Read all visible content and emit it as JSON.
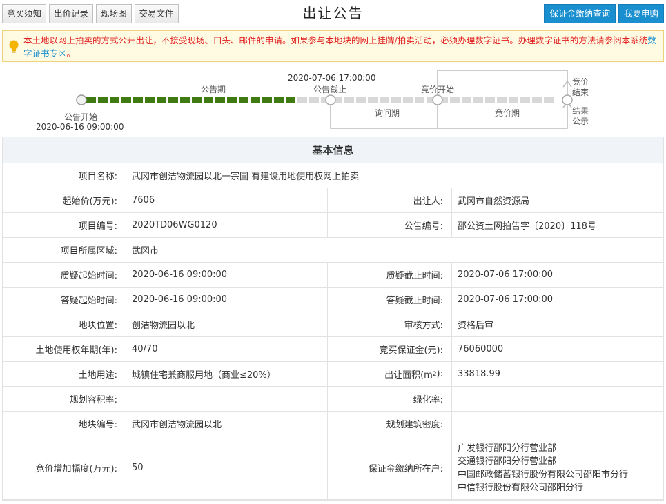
{
  "toolbar": {
    "tabs": [
      "竞买须知",
      "出价记录",
      "现场图",
      "交易文件"
    ],
    "title": "出让公告",
    "buttons": [
      "保证金缴纳查询",
      "我要申购"
    ]
  },
  "notice": {
    "text1": "本土地以网上拍卖的方式公开出让，不接受现场、口头、邮件的申请。如果参与本地块的网上挂牌/拍卖活动，必须办理数字证书。办理数字证书的方法请参阅本系统",
    "link": "数字证书专区",
    "text2": "。"
  },
  "timeline": {
    "start_label": "公告开始",
    "start_time": "2020-06-16 09:00:00",
    "period_label": "公告期",
    "deadline_time": "2020-07-06 17:00:00",
    "deadline_label": "公告截止",
    "inquiry_label": "询问期",
    "bid_start_label": "竞价开始",
    "bid_period_label": "竞价期",
    "bid_end_label1": "竞价",
    "bid_end_label2": "结束",
    "result_label1": "结果",
    "result_label2": "公示",
    "progress_fraction": 0.45,
    "colors": {
      "done": "#3f7a12",
      "pending": "#d8d8d8"
    }
  },
  "info": {
    "heading": "基本信息",
    "project_name_label": "项目名称:",
    "project_name": "武冈市创洁物流园以北一宗国 有建设用地使用权网上拍卖",
    "start_price_label": "起始价(万元):",
    "start_price": "7606",
    "seller_label": "出让人:",
    "seller": "武冈市自然资源局",
    "project_no_label": "项目编号:",
    "project_no": "2020TD06WG0120",
    "notice_no_label": "公告编号:",
    "notice_no": "邵公资土网拍告字〔2020〕118号",
    "region_label": "项目所属区域:",
    "region": "武冈市",
    "q_start_label": "质疑起始时间:",
    "q_start": "2020-06-16 09:00:00",
    "q_end_label": "质疑截止时间:",
    "q_end": "2020-07-06 17:00:00",
    "a_start_label": "答疑起始时间:",
    "a_start": "2020-06-16 09:00:00",
    "a_end_label": "答疑截止时间:",
    "a_end": "2020-07-06 17:00:00",
    "location_label": "地块位置:",
    "location": "创洁物流园以北",
    "review_label": "审核方式:",
    "review": "资格后审",
    "term_label": "土地使用权年期(年):",
    "term": "40/70",
    "deposit_label": "竞买保证金(元):",
    "deposit": "76060000",
    "usage_label": "土地用途:",
    "usage": "城镇住宅兼商服用地（商业≤20%）",
    "area_label_pre": "出让面积(m",
    "area_label_sup": "2",
    "area_label_post": "):",
    "area": "33818.99",
    "far_label": "规划容积率:",
    "far": "",
    "green_label": "绿化率:",
    "green": "",
    "parcel_label": "地块编号:",
    "parcel": "武冈市创洁物流园以北",
    "density_label": "规划建筑密度:",
    "density": "",
    "increment_label": "竞价增加幅度(万元):",
    "increment": "50",
    "bank_label": "保证金缴纳所在户:",
    "banks": [
      "广发银行邵阳分行营业部",
      "交通银行邵阳分行营业部",
      "中国邮政储蓄银行股份有限公司邵阳市分行",
      "中信银行股份有限公司邵阳分行"
    ]
  }
}
